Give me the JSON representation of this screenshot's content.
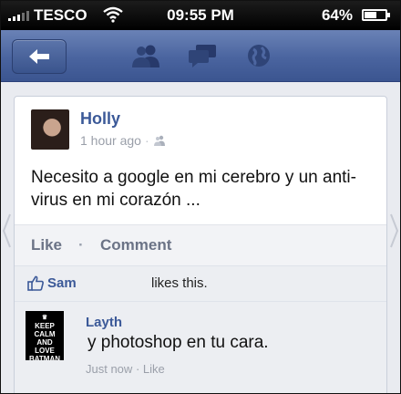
{
  "status_bar": {
    "carrier": "TESCO",
    "time": "09:55 PM",
    "battery": "64%",
    "battery_level": 0.64
  },
  "navbar": {
    "icons": [
      "back-arrow-icon",
      "friends-icon",
      "messages-icon",
      "globe-icon"
    ]
  },
  "post": {
    "author": "Holly",
    "time": "1 hour ago",
    "text": "Necesito a google en mi cerebro y un anti-virus en mi corazón ...",
    "like_label": "Like",
    "separator": "·",
    "comment_label": "Comment"
  },
  "likes": {
    "name": "Sam",
    "text": "likes this."
  },
  "comment": {
    "avatar_text": "KEEP CALM AND LOVE BATMAN",
    "author": "Layth",
    "text": "y photoshop en tu cara.",
    "time": "Just now",
    "separator": "·",
    "like_label": "Like"
  },
  "colors": {
    "facebook_blue": "#3b5998",
    "navbar_top": "#6a82b6",
    "navbar_bottom": "#3b5590"
  }
}
